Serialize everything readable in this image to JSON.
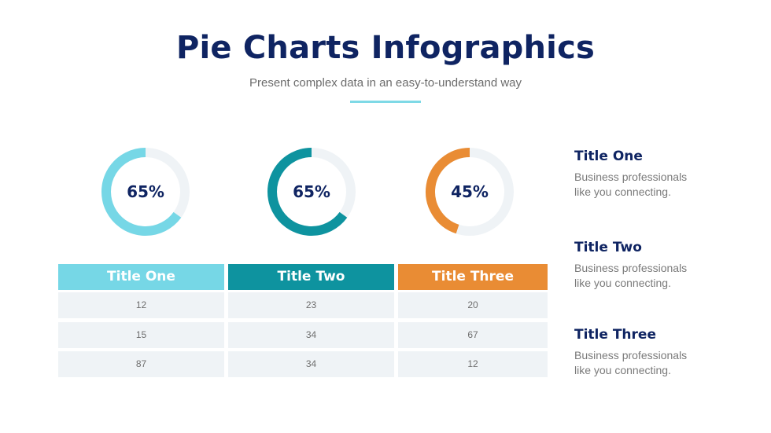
{
  "header": {
    "title": "Pie Charts Infographics",
    "subtitle": "Present complex data in an easy-to-understand way",
    "accent_color": "#7ed9e6"
  },
  "chart_data": [
    {
      "type": "pie",
      "style": "donut",
      "title": "Title One",
      "value_percent": 65,
      "label": "65%",
      "color": "#76d7e6",
      "track_color": "#eff3f6",
      "direction": "counter-clockwise from top"
    },
    {
      "type": "pie",
      "style": "donut",
      "title": "Title Two",
      "value_percent": 65,
      "label": "65%",
      "color": "#0e939f",
      "track_color": "#eff3f6",
      "direction": "counter-clockwise from top"
    },
    {
      "type": "pie",
      "style": "donut",
      "title": "Title Three",
      "value_percent": 45,
      "label": "45%",
      "color": "#e98c34",
      "track_color": "#eff3f6",
      "direction": "counter-clockwise from top"
    },
    {
      "type": "table",
      "columns": [
        {
          "header": "Title One",
          "color": "#76d7e6",
          "values": [
            "12",
            "15",
            "87"
          ]
        },
        {
          "header": "Title Two",
          "color": "#0e939f",
          "values": [
            "23",
            "34",
            "34"
          ]
        },
        {
          "header": "Title Three",
          "color": "#e98c34",
          "values": [
            "20",
            "67",
            "12"
          ]
        }
      ]
    }
  ],
  "side_items": [
    {
      "title": "Title One",
      "description_line1": "Business professionals",
      "description_line2": "like you connecting."
    },
    {
      "title": "Title Two",
      "description_line1": "Business professionals",
      "description_line2": "like you connecting."
    },
    {
      "title": "Title Three",
      "description_line1": "Business professionals",
      "description_line2": "like you connecting."
    }
  ]
}
